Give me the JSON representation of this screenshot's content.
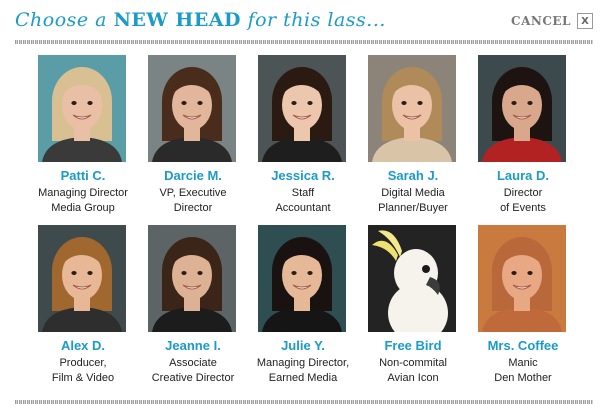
{
  "header": {
    "title_part1": "Choose a ",
    "title_part2": "NEW HEAD",
    "title_part3": " for this lass...",
    "cancel_label": "CANCEL",
    "close_label": "X"
  },
  "colors": {
    "accent": "#1a9bc8",
    "text": "#222222",
    "muted": "#777777",
    "photo_bg_dark": "#2c3032",
    "photo_bg_teal": "#5a9aa6"
  },
  "people": [
    {
      "name": "Patti C.",
      "role1": "Managing Director",
      "role2": "Media Group",
      "hair": "#d9c092",
      "skin": "#e9c0a6",
      "top": "#3a3a3a",
      "bg": "#5b9da6"
    },
    {
      "name": "Darcie M.",
      "role1": "VP, Executive",
      "role2": "Director",
      "hair": "#4a2c1c",
      "skin": "#e2b69b",
      "top": "#2a2a2a",
      "bg": "#7a8484"
    },
    {
      "name": "Jessica R.",
      "role1": "Staff",
      "role2": "Accountant",
      "hair": "#2b1a12",
      "skin": "#edc7ad",
      "top": "#1e1e1e",
      "bg": "#4c5456"
    },
    {
      "name": "Sarah J.",
      "role1": "Digital Media",
      "role2": "Planner/Buyer",
      "hair": "#b18a5a",
      "skin": "#ecc2a6",
      "top": "#d9c4a8",
      "bg": "#8c8478"
    },
    {
      "name": "Laura D.",
      "role1": "Director",
      "role2": "of Events",
      "hair": "#1d1412",
      "skin": "#d9a78b",
      "top": "#b32222",
      "bg": "#3c4a4e"
    },
    {
      "name": "Alex D.",
      "role1": "Producer,",
      "role2": "Film & Video",
      "hair": "#a0672f",
      "skin": "#e8b896",
      "top": "#2e2e2e",
      "bg": "#3f4a4c"
    },
    {
      "name": "Jeanne I.",
      "role1": "Associate",
      "role2": "Creative Director",
      "hair": "#3b2418",
      "skin": "#ddb193",
      "top": "#1c1c1c",
      "bg": "#5c6466"
    },
    {
      "name": "Julie Y.",
      "role1": "Managing Director,",
      "role2": "Earned Media",
      "hair": "#1a1210",
      "skin": "#e5b898",
      "top": "#151515",
      "bg": "#2f4e52"
    },
    {
      "name": "Free Bird",
      "role1": "Non-commital",
      "role2": "Avian Icon",
      "hair": "#f2efe6",
      "skin": "#f6f3ec",
      "top": "#2a2a2a",
      "bg": "#232323",
      "bird": true
    },
    {
      "name": "Mrs. Coffee",
      "role1": "Manic",
      "role2": "Den Mother",
      "hair": "#b8683a",
      "skin": "#e8a884",
      "top": "#c06a3c",
      "bg": "#c97a3e"
    }
  ]
}
